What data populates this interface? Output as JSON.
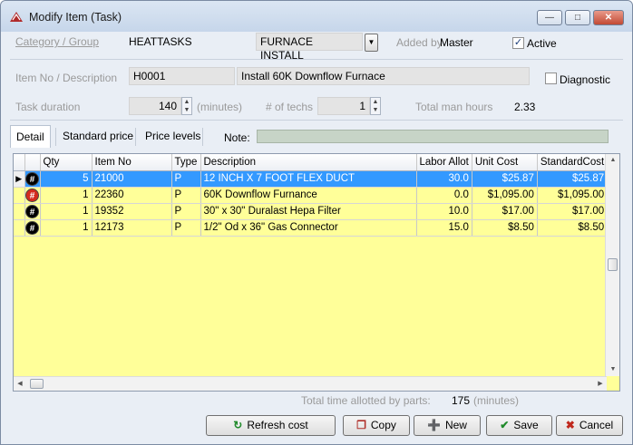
{
  "window": {
    "title": "Modify Item (Task)",
    "caption_buttons": [
      "minimize",
      "maximize",
      "close"
    ]
  },
  "header": {
    "category_label": "Category / Group",
    "category_value": "HEATTASKS",
    "group_value": "FURNACE INSTALL",
    "added_by_label": "Added by",
    "added_by_value": "Master",
    "active_label": "Active",
    "active_checked": true,
    "item_label": "Item No / Description",
    "item_no": "H0001",
    "description": "Install 60K Downflow Furnace",
    "diagnostic_label": "Diagnostic",
    "diagnostic_checked": false,
    "task_duration_label": "Task duration",
    "task_duration_value": "140",
    "minutes_label": "(minutes)",
    "techs_label": "# of techs",
    "techs_value": "1",
    "man_hours_label": "Total man hours",
    "man_hours_value": "2.33"
  },
  "tabs": [
    {
      "label": "Detail",
      "active": true
    },
    {
      "label": "Standard price",
      "active": false
    },
    {
      "label": "Price levels",
      "active": false
    }
  ],
  "note_label": "Note:",
  "note_value": "",
  "grid": {
    "columns": [
      "Qty",
      "Item No",
      "Type",
      "Description",
      "Labor Allot",
      "Unit Cost",
      "StandardCost"
    ],
    "rows": [
      {
        "icon": "#",
        "icon_color": "#000000",
        "qty": "5",
        "item_no": "21000",
        "type": "P",
        "description": "12 INCH X 7 FOOT FLEX DUCT",
        "labor": "30.0",
        "unit_cost": "$25.87",
        "std_cost": "$25.87",
        "selected": true
      },
      {
        "icon": "#",
        "icon_color": "#d42b1e",
        "qty": "1",
        "item_no": "22360",
        "type": "P",
        "description": "60K Downflow Furnance",
        "labor": "0.0",
        "unit_cost": "$1,095.00",
        "std_cost": "$1,095.00",
        "selected": false
      },
      {
        "icon": "#",
        "icon_color": "#000000",
        "qty": "1",
        "item_no": "19352",
        "type": "P",
        "description": "30\" x 30\" Duralast Hepa Filter",
        "labor": "10.0",
        "unit_cost": "$17.00",
        "std_cost": "$17.00",
        "selected": false
      },
      {
        "icon": "#",
        "icon_color": "#000000",
        "qty": "1",
        "item_no": "12173",
        "type": "P",
        "description": "1/2\" Od x 36\" Gas Connector",
        "labor": "15.0",
        "unit_cost": "$8.50",
        "std_cost": "$8.50",
        "selected": false
      }
    ],
    "row_background": "#ffff99",
    "selected_background": "#3399ff"
  },
  "footer": {
    "total_time_label": "Total time allotted by parts:",
    "total_time_value": "175",
    "total_time_unit": "(minutes)"
  },
  "buttons": {
    "refresh": "Refresh cost",
    "copy": "Copy",
    "new": "New",
    "save": "Save",
    "cancel": "Cancel"
  }
}
